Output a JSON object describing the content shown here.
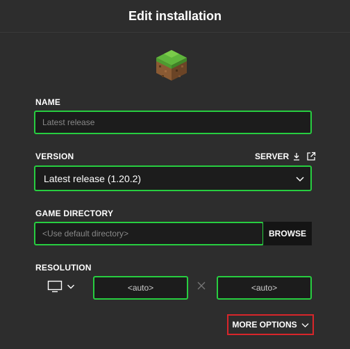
{
  "window": {
    "title": "Edit installation"
  },
  "icon": {
    "name": "grass-block-icon"
  },
  "name_field": {
    "label": "NAME",
    "placeholder": "Latest release",
    "value": ""
  },
  "version": {
    "label": "VERSION",
    "selected": "Latest release (1.20.2)",
    "server_label": "SERVER"
  },
  "game_directory": {
    "label": "GAME DIRECTORY",
    "placeholder": "<Use default directory>",
    "browse_label": "BROWSE"
  },
  "resolution": {
    "label": "RESOLUTION",
    "width_placeholder": "<auto>",
    "height_placeholder": "<auto>"
  },
  "more_options": {
    "label": "MORE OPTIONS"
  },
  "colors": {
    "background": "#2d2d2d",
    "accent_green": "#27ce40",
    "field_bg": "#1c1c1c",
    "highlight_red": "#d9252a"
  }
}
